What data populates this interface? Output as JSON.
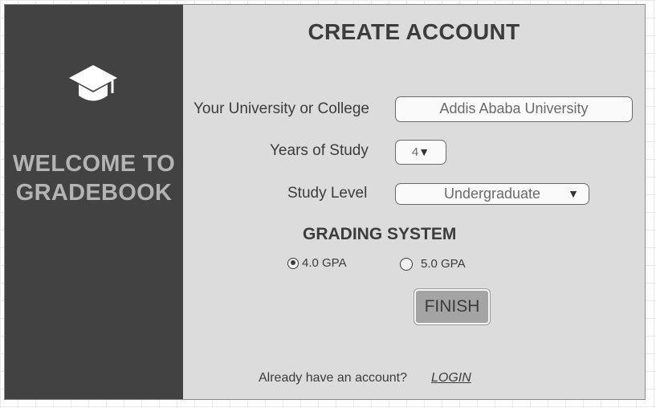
{
  "sidebar": {
    "welcome_line1": "WELCOME TO",
    "welcome_line2": "GRADEBOOK",
    "icon": "graduation-cap-icon"
  },
  "main": {
    "title": "CREATE ACCOUNT",
    "university_label": "Your University or College",
    "university_value": "Addis Ababa University",
    "years_label": "Years of Study",
    "years_value": "4",
    "level_label": "Study Level",
    "level_value": "Undergraduate",
    "grading_title": "GRADING SYSTEM",
    "grading_options": [
      {
        "label": "4.0 GPA",
        "selected": true
      },
      {
        "label": "5.0 GPA",
        "selected": false
      }
    ],
    "finish_label": "FINISH",
    "footer_text": "Already have an account?",
    "login_label": "LOGIN"
  },
  "colors": {
    "sidebar_bg": "#424242",
    "main_bg": "#dcdcdc",
    "welcome_text": "#b4b4b4",
    "button_bg": "#a4a4a4"
  }
}
